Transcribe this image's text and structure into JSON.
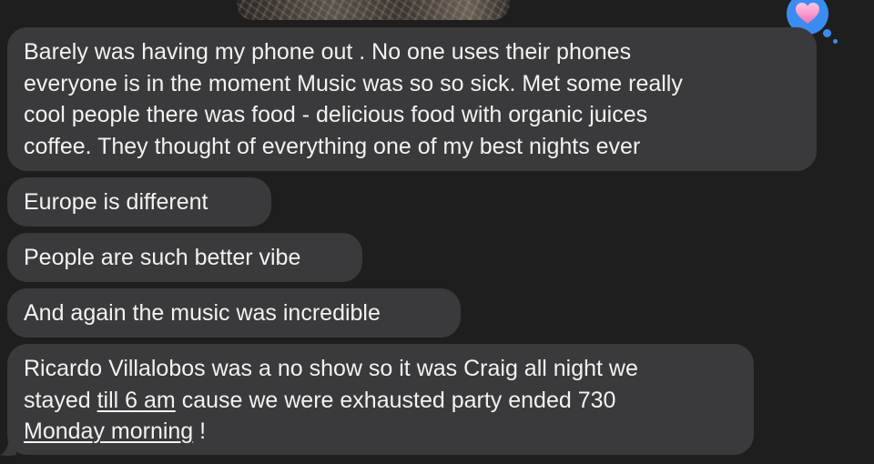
{
  "messages": [
    {
      "lines": [
        "Barely was having my phone out . No one uses their  phones",
        "everyone is in the moment Music was so so sick.  Met some really",
        "cool people  there was  food - delicious food with organic juices",
        "coffee. They thought of everything  one of my best nights ever"
      ]
    },
    {
      "text": "Europe is different"
    },
    {
      "text": "People are such better vibe"
    },
    {
      "text": "And again the music was incredible"
    },
    {
      "line1": "Ricardo Villalobos was a no show so it was Craig all night we",
      "line2_pre": "stayed ",
      "line2_link": "till 6 am",
      "line2_post": " cause we were exhausted party ended 730",
      "line3_link": "Monday morning",
      "line3_post": " !"
    }
  ],
  "reaction": {
    "icon": "heart-icon",
    "color": "#3b8cf0",
    "heart_color": "#f58fc7"
  },
  "colors": {
    "background": "#1e1e1e",
    "bubble": "#3a3a3c",
    "text": "#f2f2f2"
  }
}
